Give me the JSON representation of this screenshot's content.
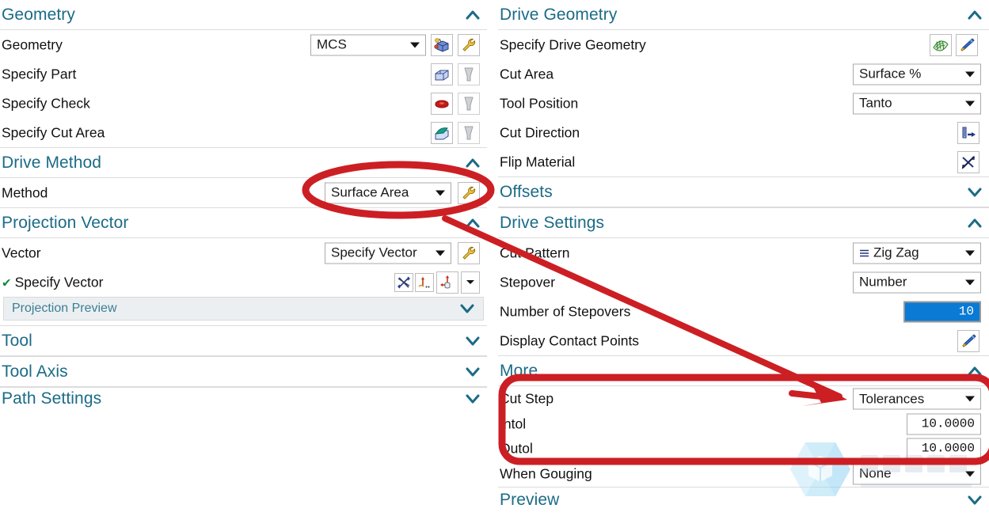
{
  "left_panel": {
    "sections": [
      {
        "id": "geometry",
        "title": "Geometry",
        "expanded_icon": "chevron-up-icon",
        "rows": [
          {
            "label": "Geometry",
            "combo": "MCS",
            "icons": [
              "mcs-cube-icon",
              "wrench-icon"
            ]
          },
          {
            "label": "Specify Part",
            "icons": [
              "part-body-icon",
              "select-cursor-icon"
            ]
          },
          {
            "label": "Specify Check",
            "icons": [
              "check-body-icon",
              "select-cursor-icon"
            ]
          },
          {
            "label": "Specify Cut Area",
            "icons": [
              "cut-area-icon",
              "select-cursor-icon"
            ]
          }
        ]
      },
      {
        "id": "drive-method",
        "title": "Drive Method",
        "expanded_icon": "chevron-up-icon",
        "rows": [
          {
            "label": "Method",
            "combo": "Surface Area",
            "icons": [
              "wrench-icon"
            ]
          }
        ]
      },
      {
        "id": "projection-vector",
        "title": "Projection Vector",
        "expanded_icon": "chevron-up-icon",
        "rows": [
          {
            "label": "Vector",
            "combo": "Specify Vector",
            "icons": [
              "wrench-icon"
            ]
          },
          {
            "label": "Specify Vector",
            "checked": true,
            "icons": [
              "vector-flip-icon",
              "vector-point-icon",
              "vector-axis-icon",
              "dropdown-caret-icon"
            ]
          }
        ]
      }
    ],
    "subbar": {
      "label": "Projection Preview",
      "collapsed_icon": "chevron-down-icon"
    },
    "collapsed_sections": [
      {
        "title": "Tool",
        "collapsed_icon": "chevron-down-icon"
      },
      {
        "title": "Tool Axis",
        "collapsed_icon": "chevron-down-icon"
      },
      {
        "title": "Path Settings",
        "collapsed_icon": "chevron-down-icon"
      }
    ]
  },
  "right_panel": {
    "sections": [
      {
        "id": "drive-geometry",
        "title": "Drive Geometry",
        "expanded_icon": "chevron-up-icon",
        "rows": [
          {
            "label": "Specify Drive Geometry",
            "icons": [
              "surface-mesh-icon",
              "flashlight-icon"
            ]
          },
          {
            "label": "Cut Area",
            "combo": "Surface %"
          },
          {
            "label": "Tool Position",
            "combo": "Tanto"
          },
          {
            "label": "Cut Direction",
            "icons": [
              "cut-direction-icon"
            ]
          },
          {
            "label": "Flip Material",
            "icons": [
              "flip-material-icon"
            ]
          }
        ]
      },
      {
        "id": "offsets",
        "title": "Offsets",
        "collapsed_icon": "chevron-down-icon",
        "rows": []
      },
      {
        "id": "drive-settings",
        "title": "Drive Settings",
        "expanded_icon": "chevron-up-icon",
        "rows": [
          {
            "label": "Cut Pattern",
            "combo": "Zig Zag",
            "combo_icon": "zigzag-pattern-icon"
          },
          {
            "label": "Stepover",
            "combo": "Number"
          },
          {
            "label": "Number of Stepovers",
            "field": "10",
            "selected": true
          },
          {
            "label": "Display Contact Points",
            "icons": [
              "flashlight-icon"
            ]
          }
        ]
      },
      {
        "id": "more",
        "title": "More",
        "expanded_icon": "chevron-up-icon",
        "rows": [
          {
            "label": "Cut Step",
            "combo": "Tolerances"
          },
          {
            "label": "Intol",
            "field": "10.0000"
          },
          {
            "label": "Outol",
            "field": "10.0000"
          },
          {
            "label": "When Gouging",
            "combo": "None"
          }
        ]
      },
      {
        "id": "preview",
        "title": "Preview",
        "collapsed_icon": "chevron-down-icon",
        "rows": []
      }
    ]
  },
  "annotations": {
    "color": "#cc1f24",
    "shapes": [
      {
        "kind": "ellipse",
        "name": "highlight-ellipse-drive-method"
      },
      {
        "kind": "arrow",
        "name": "pointer-arrow-to-cut-step"
      },
      {
        "kind": "rectangle",
        "name": "highlight-rect-tolerances"
      },
      {
        "kind": "tick",
        "name": "arrow-tail-tick"
      }
    ]
  },
  "watermark": {
    "name": "hexagon-logo-watermark",
    "color": "#8ecff0"
  },
  "colors": {
    "header_text": "#1b6b87",
    "body_text": "#111111",
    "selection_blue": "#0a7ad4",
    "annotation_red": "#cc1f24",
    "border_gray": "#a9a9a9"
  }
}
